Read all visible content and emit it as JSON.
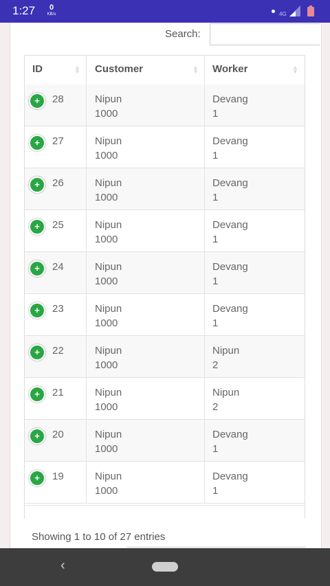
{
  "status_bar": {
    "time": "1:27",
    "net_speed_value": "0",
    "net_speed_unit": "KB/s",
    "network": "4G"
  },
  "search": {
    "label": "Search:",
    "value": ""
  },
  "table": {
    "columns": [
      "ID",
      "Customer",
      "Worker"
    ],
    "rows": [
      {
        "id": "28",
        "customer": [
          "Nipun",
          "1000"
        ],
        "worker": [
          "Devang",
          "1"
        ]
      },
      {
        "id": "27",
        "customer": [
          "Nipun",
          "1000"
        ],
        "worker": [
          "Devang",
          "1"
        ]
      },
      {
        "id": "26",
        "customer": [
          "Nipun",
          "1000"
        ],
        "worker": [
          "Devang",
          "1"
        ]
      },
      {
        "id": "25",
        "customer": [
          "Nipun",
          "1000"
        ],
        "worker": [
          "Devang",
          "1"
        ]
      },
      {
        "id": "24",
        "customer": [
          "Nipun",
          "1000"
        ],
        "worker": [
          "Devang",
          "1"
        ]
      },
      {
        "id": "23",
        "customer": [
          "Nipun",
          "1000"
        ],
        "worker": [
          "Devang",
          "1"
        ]
      },
      {
        "id": "22",
        "customer": [
          "Nipun",
          "1000"
        ],
        "worker": [
          "Nipun",
          "2"
        ]
      },
      {
        "id": "21",
        "customer": [
          "Nipun",
          "1000"
        ],
        "worker": [
          "Nipun",
          "2"
        ]
      },
      {
        "id": "20",
        "customer": [
          "Nipun",
          "1000"
        ],
        "worker": [
          "Devang",
          "1"
        ]
      },
      {
        "id": "19",
        "customer": [
          "Nipun",
          "1000"
        ],
        "worker": [
          "Devang",
          "1"
        ]
      }
    ]
  },
  "info": "Showing 1 to 10 of 27 entries",
  "icons": {
    "expand": "plus-circle-icon",
    "sort": "sort-arrows-icon",
    "back": "back-chevron-icon",
    "home": "home-pill-icon"
  },
  "colors": {
    "status_bar": "#3a31b5",
    "expand_button": "#29a745",
    "nav_bar": "#3d3d3d"
  }
}
